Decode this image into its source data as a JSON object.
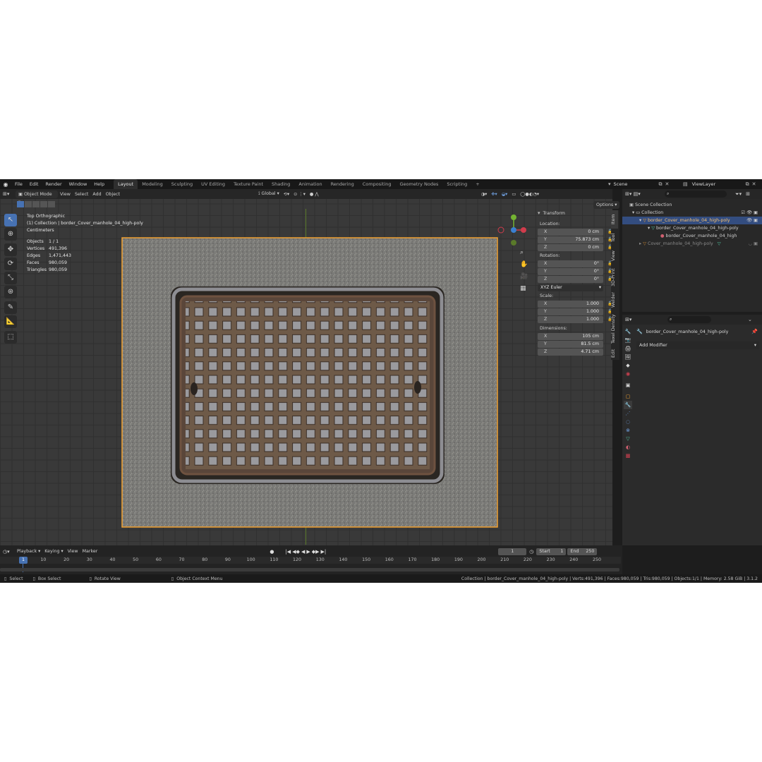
{
  "menus": [
    "File",
    "Edit",
    "Render",
    "Window",
    "Help"
  ],
  "workspaces": [
    "Layout",
    "Modeling",
    "Sculpting",
    "UV Editing",
    "Texture Paint",
    "Shading",
    "Animation",
    "Rendering",
    "Compositing",
    "Geometry Nodes",
    "Scripting"
  ],
  "active_workspace": "Layout",
  "scene_name": "Scene",
  "view_layer": "ViewLayer",
  "header": {
    "mode": "Object Mode",
    "view": "View",
    "select": "Select",
    "add": "Add",
    "object": "Object",
    "orientation": "Global",
    "options": "Options"
  },
  "viewport_info": {
    "view_name": "Top Orthographic",
    "collection_line": "(1) Collection | border_Cover_manhole_04_high-poly",
    "units": "Centimeters",
    "stats": [
      {
        "label": "Objects",
        "value": "1 / 1"
      },
      {
        "label": "Vertices",
        "value": "491,396"
      },
      {
        "label": "Edges",
        "value": "1,471,443"
      },
      {
        "label": "Faces",
        "value": "980,059"
      },
      {
        "label": "Triangles",
        "value": "980,059"
      }
    ]
  },
  "transform": {
    "title": "Transform",
    "location_label": "Location:",
    "location": [
      {
        "axis": "X",
        "value": "0 cm"
      },
      {
        "axis": "Y",
        "value": "75.873 cm"
      },
      {
        "axis": "Z",
        "value": "0 cm"
      }
    ],
    "rotation_label": "Rotation:",
    "rotation": [
      {
        "axis": "X",
        "value": "0°"
      },
      {
        "axis": "Y",
        "value": "0°"
      },
      {
        "axis": "Z",
        "value": "0°"
      }
    ],
    "rotation_mode": "XYZ Euler",
    "scale_label": "Scale:",
    "scale": [
      {
        "axis": "X",
        "value": "1.000"
      },
      {
        "axis": "Y",
        "value": "1.000"
      },
      {
        "axis": "Z",
        "value": "1.000"
      }
    ],
    "dimensions_label": "Dimensions:",
    "dimensions": [
      {
        "axis": "X",
        "value": "105 cm"
      },
      {
        "axis": "Y",
        "value": "81.5 cm"
      },
      {
        "axis": "Z",
        "value": "4.71 cm"
      }
    ]
  },
  "sidebar_tabs": [
    "Item",
    "Tool",
    "View",
    "3D-Print",
    "Welder",
    "Texel Density",
    "Edit"
  ],
  "outliner": {
    "scene_collection": "Scene Collection",
    "collection": "Collection",
    "items": [
      {
        "name": "border_Cover_manhole_04_high-poly"
      },
      {
        "name": "border_Cover_manhole_04_high-poly"
      },
      {
        "name": "border_Cover_manhole_04_high"
      },
      {
        "name": "Cover_manhole_04_high-poly"
      }
    ]
  },
  "properties": {
    "object_name": "border_Cover_manhole_04_high-poly",
    "add_modifier": "Add Modifier"
  },
  "timeline": {
    "playback": "Playback",
    "keying": "Keying",
    "view": "View",
    "marker": "Marker",
    "current_frame": "1",
    "start_label": "Start",
    "start": "1",
    "end_label": "End",
    "end": "250",
    "cursor_frame": "1",
    "ticks": [
      "10",
      "20",
      "30",
      "40",
      "50",
      "60",
      "70",
      "80",
      "90",
      "100",
      "110",
      "120",
      "130",
      "140",
      "150",
      "160",
      "170",
      "180",
      "190",
      "200",
      "210",
      "220",
      "230",
      "240",
      "250"
    ]
  },
  "status": {
    "select": "Select",
    "box_select": "Box Select",
    "rotate_view": "Rotate View",
    "context_menu": "Object Context Menu",
    "summary": "Collection | border_Cover_manhole_04_high-poly | Verts:491,396 | Faces:980,059 | Tris:980,059 | Objects:1/1 | Memory: 2.58 GiB | 3.1.2"
  },
  "colors": {
    "accent": "#4772b3",
    "selection_outline": "#f0a030",
    "axis_x": "#d03c4c",
    "axis_y": "#74b332",
    "axis_z": "#3a80d0"
  }
}
